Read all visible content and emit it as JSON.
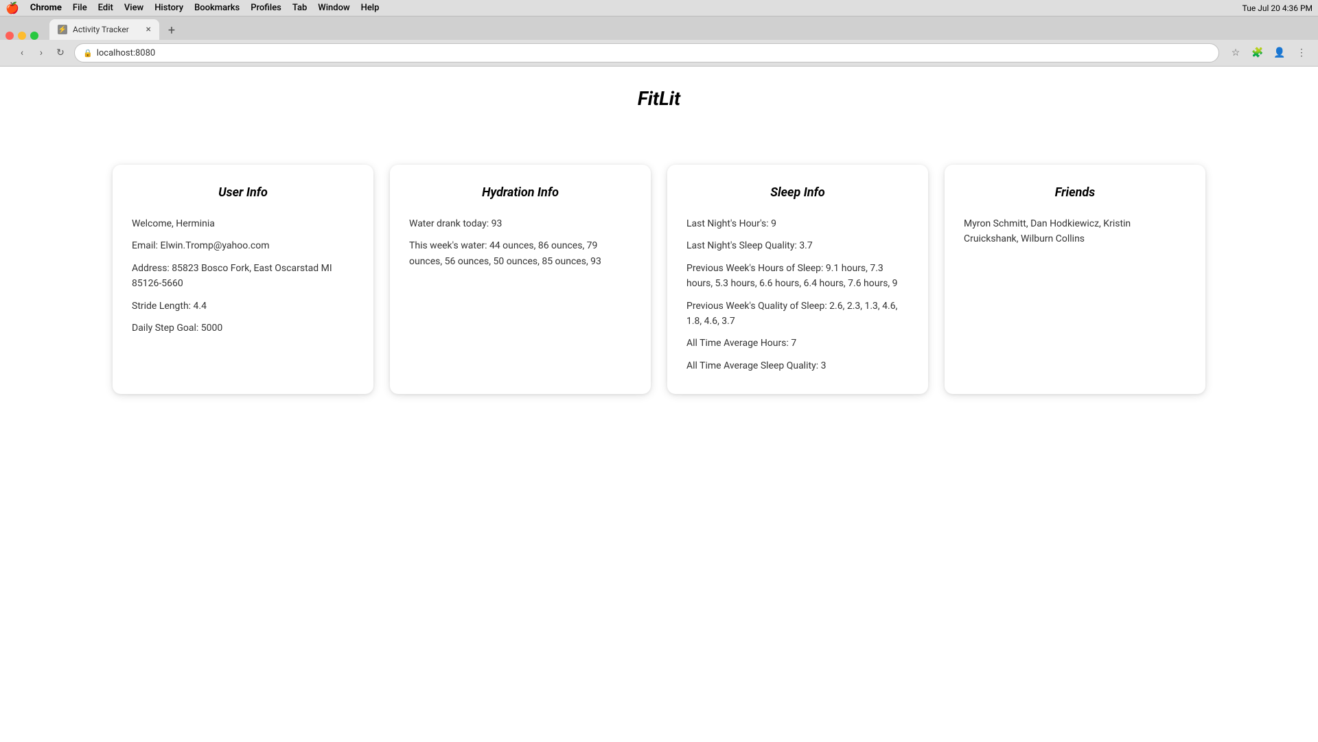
{
  "os": {
    "menu_bar": {
      "apple": "🍎",
      "items": [
        "Chrome",
        "File",
        "Edit",
        "View",
        "History",
        "Bookmarks",
        "Profiles",
        "Tab",
        "Window",
        "Help"
      ],
      "time": "Tue Jul 20  4:36 PM"
    }
  },
  "browser": {
    "tab_title": "Activity Tracker",
    "address": "localhost:8080",
    "new_tab_symbol": "+",
    "close_symbol": "×",
    "nav": {
      "back": "‹",
      "forward": "›",
      "refresh": "↻"
    }
  },
  "app": {
    "title": "FitLit",
    "cards": {
      "user_info": {
        "title": "User Info",
        "welcome": "Welcome, Herminia",
        "email": "Email: Elwin.Tromp@yahoo.com",
        "address": "Address: 85823 Bosco Fork, East Oscarstad MI 85126-5660",
        "stride_length": "Stride Length: 4.4",
        "daily_step_goal": "Daily Step Goal: 5000"
      },
      "hydration_info": {
        "title": "Hydration Info",
        "water_today": "Water drank today: 93",
        "weeks_water": "This week's water: 44 ounces, 86 ounces, 79 ounces, 56 ounces, 50 ounces, 85 ounces, 93"
      },
      "sleep_info": {
        "title": "Sleep Info",
        "last_night_hours": "Last Night's Hour's: 9",
        "last_night_quality": "Last Night's Sleep Quality: 3.7",
        "prev_week_hours": "Previous Week's Hours of Sleep: 9.1 hours, 7.3 hours, 5.3 hours, 6.6 hours, 6.4 hours, 7.6 hours, 9",
        "prev_week_quality": "Previous Week's Quality of Sleep: 2.6, 2.3, 1.3, 4.6, 1.8, 4.6, 3.7",
        "all_time_avg_hours": "All Time Average Hours: 7",
        "all_time_avg_quality": "All Time Average Sleep Quality: 3"
      },
      "friends": {
        "title": "Friends",
        "friends_list": "Myron Schmitt, Dan Hodkiewicz, Kristin Cruickshank, Wilburn Collins"
      }
    }
  }
}
